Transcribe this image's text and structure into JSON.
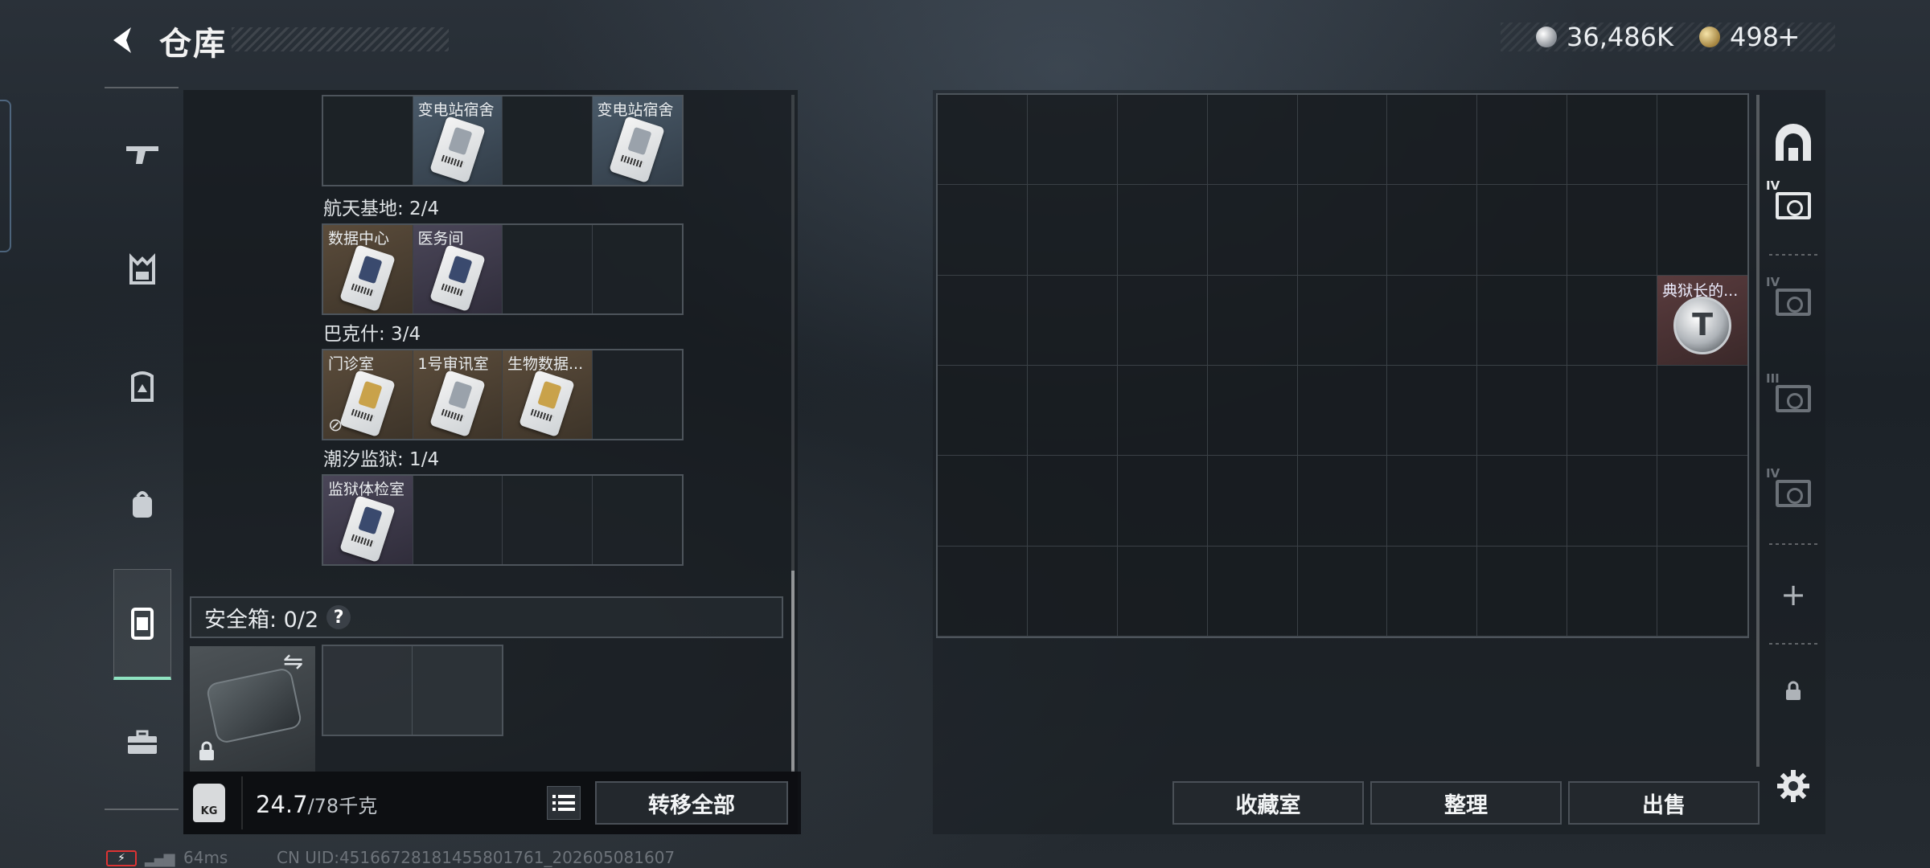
{
  "header": {
    "title": "仓库",
    "currency": [
      {
        "icon": "silver-coin-icon",
        "value": "36,486K"
      },
      {
        "icon": "gold-coin-icon",
        "value": "498"
      }
    ],
    "add_label": "+"
  },
  "left_nav": [
    {
      "id": "weapons",
      "icon": "pistol-icon"
    },
    {
      "id": "armor",
      "icon": "vest-icon"
    },
    {
      "id": "rig",
      "icon": "chest-rig-icon"
    },
    {
      "id": "backpack",
      "icon": "backpack-icon"
    },
    {
      "id": "keys",
      "icon": "key-case-icon",
      "active": true
    },
    {
      "id": "toolbox",
      "icon": "toolbox-icon"
    }
  ],
  "key_maps": [
    {
      "label": "",
      "slots": [
        {
          "name": ""
        },
        {
          "name": "变电站宿舍",
          "color": "blue"
        },
        {
          "name": ""
        },
        {
          "name": "变电站宿舍",
          "color": "blue"
        }
      ]
    },
    {
      "label": "航天基地: 2/4",
      "slots": [
        {
          "name": "数据中心",
          "color": "brown"
        },
        {
          "name": "医务间",
          "color": "purple"
        },
        {
          "name": ""
        },
        {
          "name": ""
        }
      ]
    },
    {
      "label": "巴克什: 3/4",
      "slots": [
        {
          "name": "门诊室",
          "color": "brown"
        },
        {
          "name": "1号审讯室",
          "color": "brown"
        },
        {
          "name": "生物数据...",
          "color": "brown"
        },
        {
          "name": ""
        }
      ]
    },
    {
      "label": "潮汐监狱: 1/4",
      "slots": [
        {
          "name": "监狱体检室",
          "color": "purple"
        },
        {
          "name": ""
        },
        {
          "name": ""
        },
        {
          "name": ""
        }
      ]
    }
  ],
  "safe_box": {
    "title": "安全箱: 0/2",
    "help": "?"
  },
  "weight": {
    "badge": "KG",
    "current": "24.7",
    "total": "/78千克"
  },
  "buttons": {
    "transfer_all": "转移全部",
    "collection": "收藏室",
    "organize": "整理",
    "sell": "出售"
  },
  "stash": {
    "columns": 9,
    "rows": 6,
    "items": [
      {
        "name": "典狱长的...",
        "row": 3,
        "col": 9,
        "icon": "medal-icon"
      }
    ]
  },
  "right_rail": [
    {
      "icon": "stash-home-icon"
    },
    {
      "icon": "case-iv-icon",
      "tier": "IV"
    },
    {
      "icon": "case-iv-icon",
      "tier": "IV"
    },
    {
      "icon": "case-iii-icon",
      "tier": "III"
    },
    {
      "icon": "case-iv-icon",
      "tier": "IV"
    },
    {
      "icon": "plus-icon",
      "glyph": "+"
    },
    {
      "icon": "lock-icon"
    },
    {
      "icon": "settings-gear-icon"
    }
  ],
  "status": {
    "ping": "64ms",
    "uid": "CN UID:451667281814558017​61_202605081607"
  }
}
